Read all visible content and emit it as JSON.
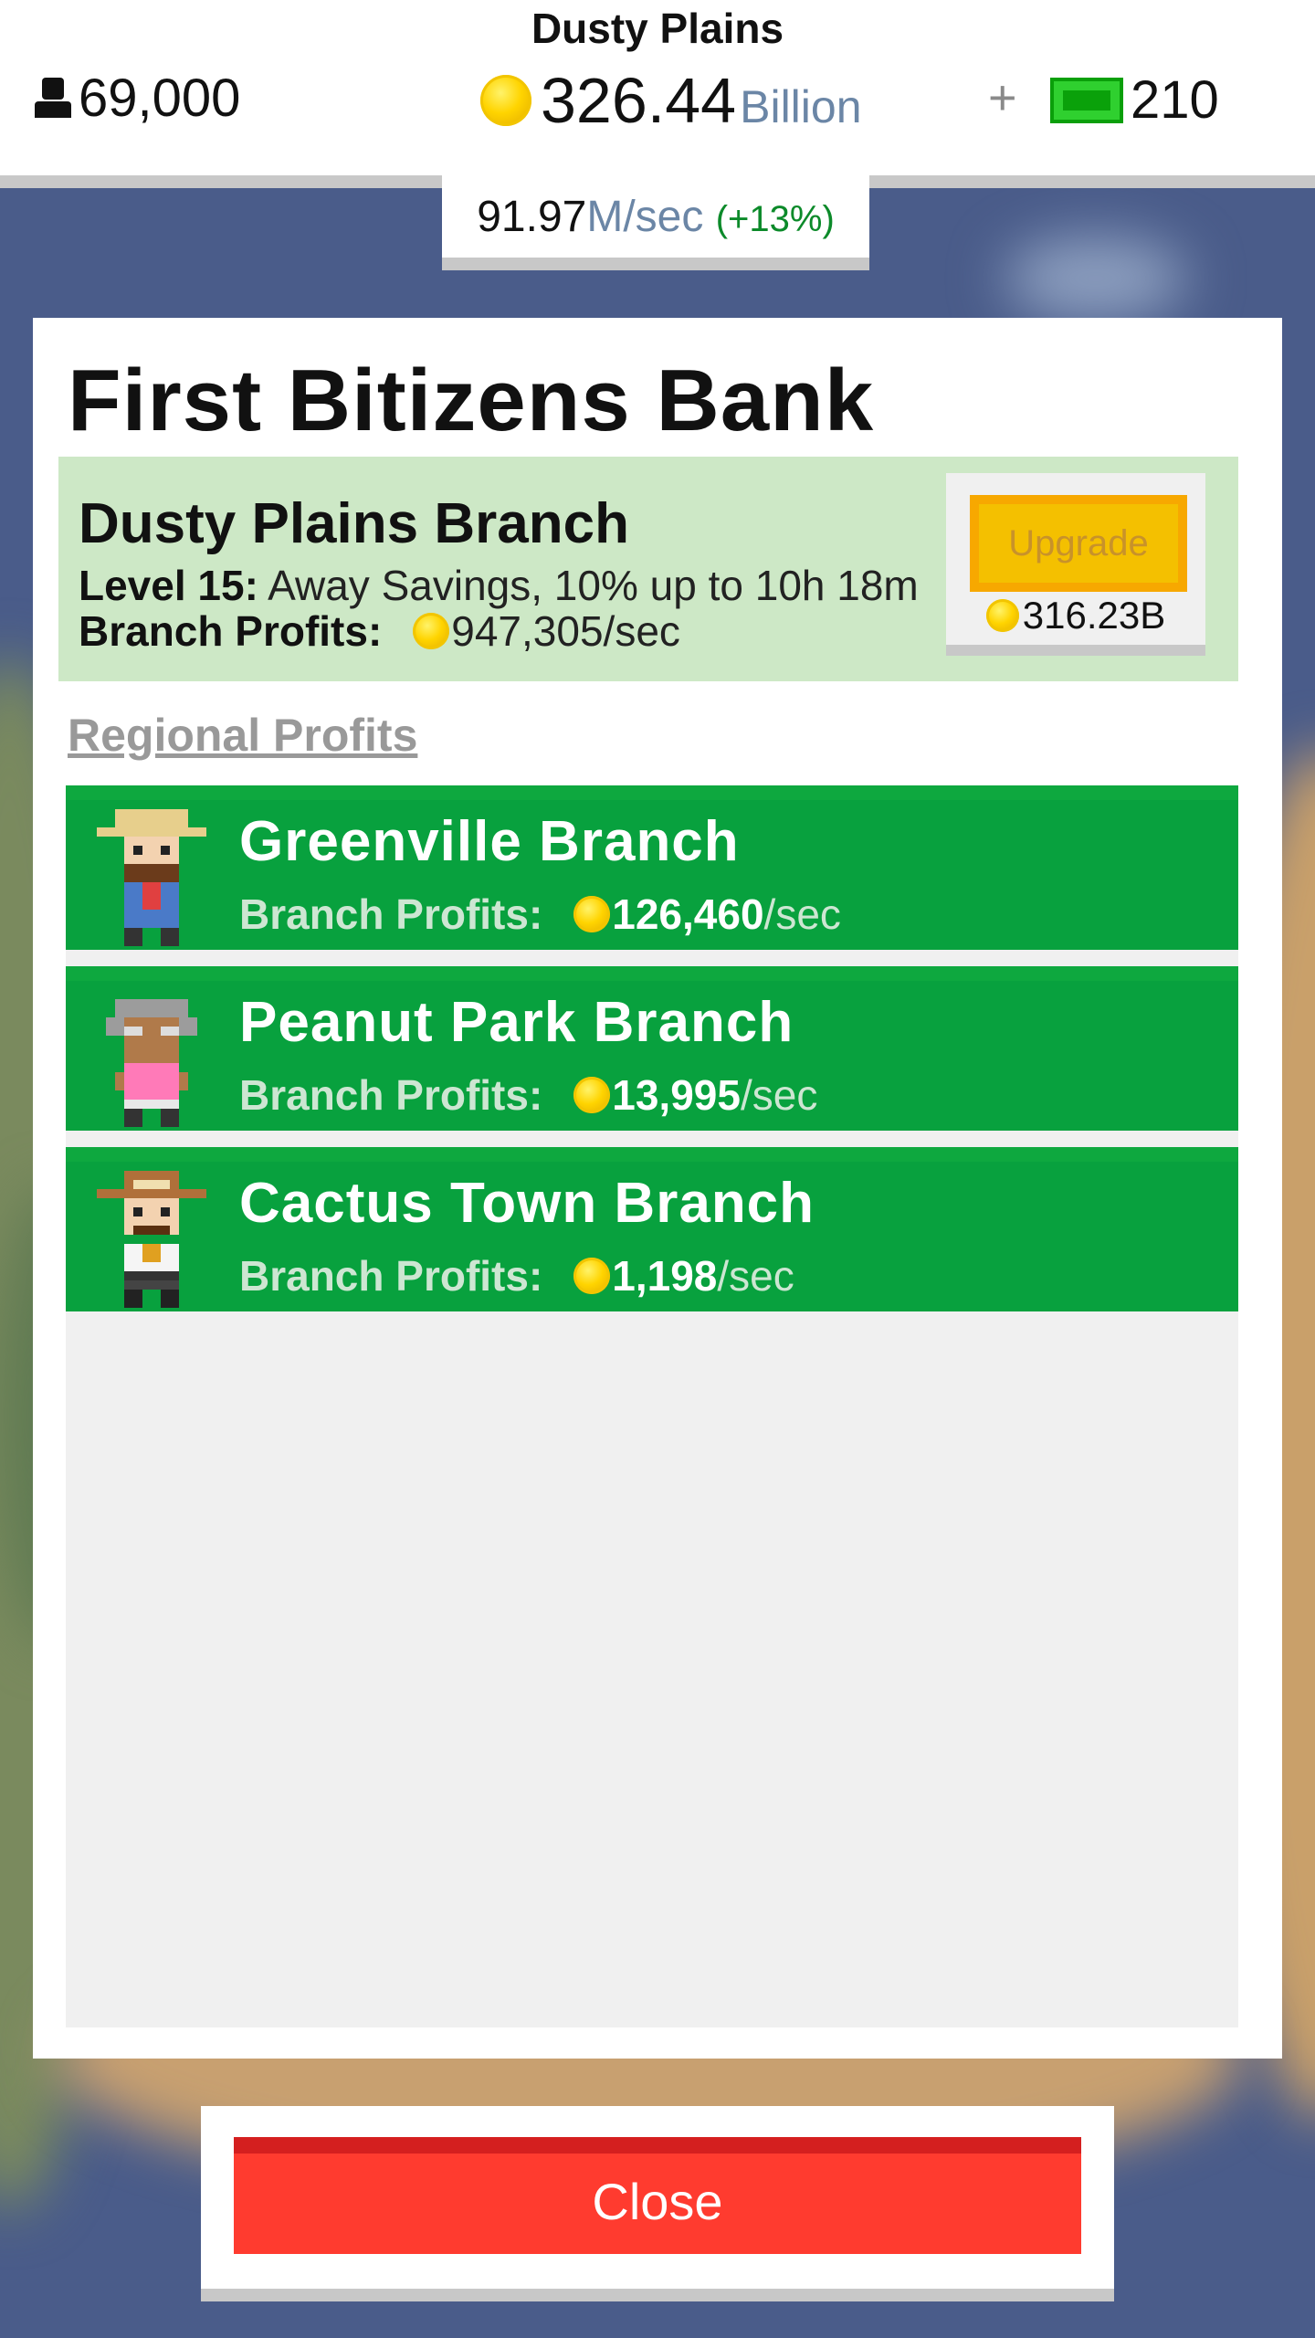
{
  "hud": {
    "location": "Dusty Plains",
    "population": "69,000",
    "coins_value": "326.44",
    "coins_unit": "Billion",
    "plus_label": "+",
    "bux": "210",
    "rate_value": "91.97",
    "rate_unit": "M/sec",
    "rate_bonus": "(+13%)"
  },
  "modal": {
    "title": "First Bitizens Bank",
    "branch": {
      "name": "Dusty Plains Branch",
      "level_label": "Level 15:",
      "level_text": "Away Savings, 10% up to 10h 18m",
      "profits_label": "Branch Profits:",
      "profits_value": "947,305/sec",
      "upgrade_label": "Upgrade",
      "upgrade_cost": "316.23B"
    },
    "regional_label": "Regional Profits",
    "regional": [
      {
        "name": "Greenville Branch",
        "profits_label": "Branch Profits:",
        "value": "126,460",
        "per": "/sec",
        "avatar": "farmer-avatar-icon"
      },
      {
        "name": "Peanut Park Branch",
        "profits_label": "Branch Profits:",
        "value": "13,995",
        "per": "/sec",
        "avatar": "grandma-avatar-icon"
      },
      {
        "name": "Cactus Town Branch",
        "profits_label": "Branch Profits:",
        "value": "1,198",
        "per": "/sec",
        "avatar": "cowboy-avatar-icon"
      }
    ]
  },
  "close_label": "Close",
  "colors": {
    "accent_green": "#08a13e",
    "branch_bg": "#cde8c6",
    "upgrade_yellow": "#f4c000",
    "close_red": "#ff3b2f"
  }
}
